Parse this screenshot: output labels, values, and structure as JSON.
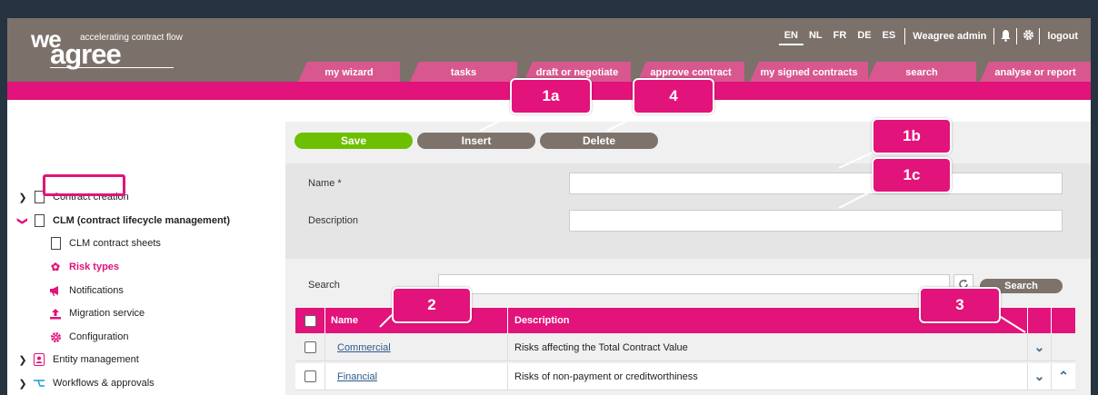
{
  "brand": {
    "logo_we": "we",
    "logo_agree": "agree",
    "tagline": "accelerating contract flow"
  },
  "topnav": {
    "languages": [
      "EN",
      "NL",
      "FR",
      "DE",
      "ES"
    ],
    "active_language": "EN",
    "user": "Weagree admin",
    "bell_icon": "bell-icon",
    "gear_icon": "gear-icon",
    "logout": "logout"
  },
  "tabs": [
    "my wizard",
    "tasks",
    "draft or negotiate",
    "approve contract",
    "my signed contracts",
    "search",
    "analyse or report"
  ],
  "sidebar": {
    "items": [
      {
        "label": "Contract creation",
        "icon": "document-icon"
      },
      {
        "label": "CLM (contract lifecycle management)",
        "icon": "document-icon"
      },
      {
        "label": "CLM contract sheets",
        "icon": "document-icon"
      },
      {
        "label": "Risk types",
        "icon": "fire-icon"
      },
      {
        "label": "Notifications",
        "icon": "megaphone-icon"
      },
      {
        "label": "Migration service",
        "icon": "upload-icon"
      },
      {
        "label": "Configuration",
        "icon": "gear-icon"
      },
      {
        "label": "Entity management",
        "icon": "contact-icon"
      },
      {
        "label": "Workflows & approvals",
        "icon": "flow-icon"
      }
    ]
  },
  "toolbar": {
    "save": "Save",
    "insert": "Insert",
    "delete": "Delete"
  },
  "form": {
    "name_label": "Name *",
    "name_value": "",
    "description_label": "Description",
    "description_value": ""
  },
  "search": {
    "label": "Search",
    "value": "",
    "button": "Search"
  },
  "table": {
    "columns": [
      "Name",
      "Description"
    ],
    "rows": [
      {
        "name": "Commercial",
        "description": "Risks affecting the Total Contract Value"
      },
      {
        "name": "Financial",
        "description": "Risks of non-payment or creditworthiness"
      }
    ]
  },
  "callouts": {
    "c1a": "1a",
    "c4": "4",
    "c1b": "1b",
    "c1c": "1c",
    "c2": "2",
    "c3": "3"
  },
  "colors": {
    "brand_pink": "#e2137a",
    "header_brown": "#7c716a",
    "save_green": "#6cc000",
    "button_gray": "#7d736b",
    "link_blue": "#2d5a8c"
  }
}
